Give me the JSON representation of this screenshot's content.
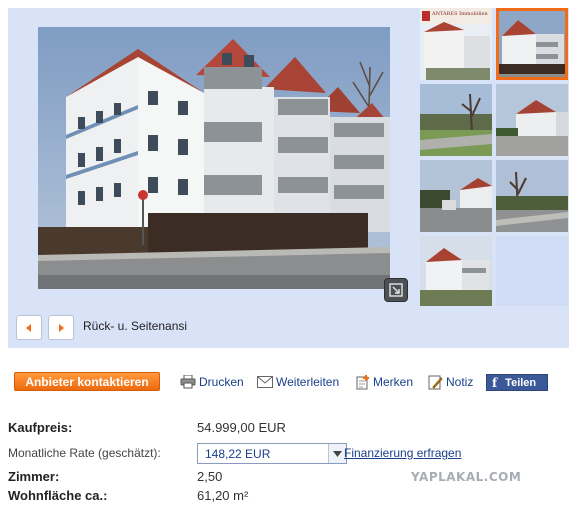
{
  "gallery": {
    "caption": "Rück- u. Seitenansi",
    "thumb_logo_text": "ANTARES Immobilien"
  },
  "actions": {
    "contact": "Anbieter kontaktieren",
    "print": "Drucken",
    "forward": "Weiterleiten",
    "remember": "Merken",
    "note": "Notiz",
    "facebook": "Teilen"
  },
  "details": {
    "price_label": "Kaufpreis:",
    "price_value": "54.999,00 EUR",
    "rate_label": "Monatliche Rate (geschätzt):",
    "rate_value": "148,22 EUR",
    "rate_link": "Finanzierung erfragen",
    "rooms_label": "Zimmer:",
    "rooms_value": "2,50",
    "area_label": "Wohnfläche ca.:",
    "area_value": "61,20 m²"
  },
  "watermark": "YAPLAKAL.COM",
  "colors": {
    "accent_orange": "#f26b18",
    "link_blue": "#1a3f8b",
    "gallery_bg": "#d8e3f7",
    "facebook_blue": "#3b5998"
  }
}
